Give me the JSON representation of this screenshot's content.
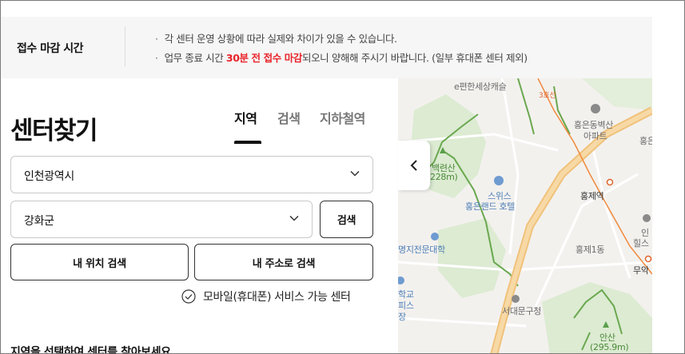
{
  "notice": {
    "title": "접수 마감 시간",
    "line1": "각 센터 운영 상황에 따라 실제와 차이가 있을 수 있습니다.",
    "line2_pre": "업무 종료 시간 ",
    "line2_highlight": "30분 전 접수 마감",
    "line2_post": "되오니 양해해 주시기 바랍니다. (일부 휴대폰 센터 제외)",
    "highlight_color": "#e8232a"
  },
  "panel": {
    "title": "센터찾기",
    "tabs": [
      {
        "label": "지역",
        "active": true
      },
      {
        "label": "검색",
        "active": false
      },
      {
        "label": "지하철역",
        "active": false
      }
    ],
    "region_select": {
      "value": "인천광역시",
      "icon": "chevron-down-icon"
    },
    "district_select": {
      "value": "강화군",
      "icon": "chevron-down-icon"
    },
    "search_button": "검색",
    "my_location_button": "내 위치 검색",
    "my_address_button": "내 주소로 검색",
    "mobile_service_label": "모바일(휴대폰) 서비스 가능 센터",
    "mobile_service_icon": "check-circle-icon",
    "instruction_text": "지역을 선택하여 센터를 찾아보세요"
  },
  "map": {
    "collapse_icon": "chevron-left-icon",
    "labels": {
      "top": "e편한세상캐슬",
      "road": "3호선",
      "apt": "홍은동벽산",
      "apt2": "아파트",
      "hongeun_cut": "홍은",
      "mountain1": "백련산",
      "mountain1_h": "228m)",
      "hotel1": "스위스",
      "hotel2": "홍은랜드 호텔",
      "station": "홍제역",
      "right_cut1": "인",
      "right_cut2": "힐스",
      "college": "명지전문대학",
      "hongje1": "홍제1동",
      "muak": "무악",
      "school1": "학교",
      "school2": "피스",
      "school3": "장",
      "office": "서대문구청",
      "mountain2": "안산",
      "mountain2_h": "(295.9m)"
    }
  }
}
